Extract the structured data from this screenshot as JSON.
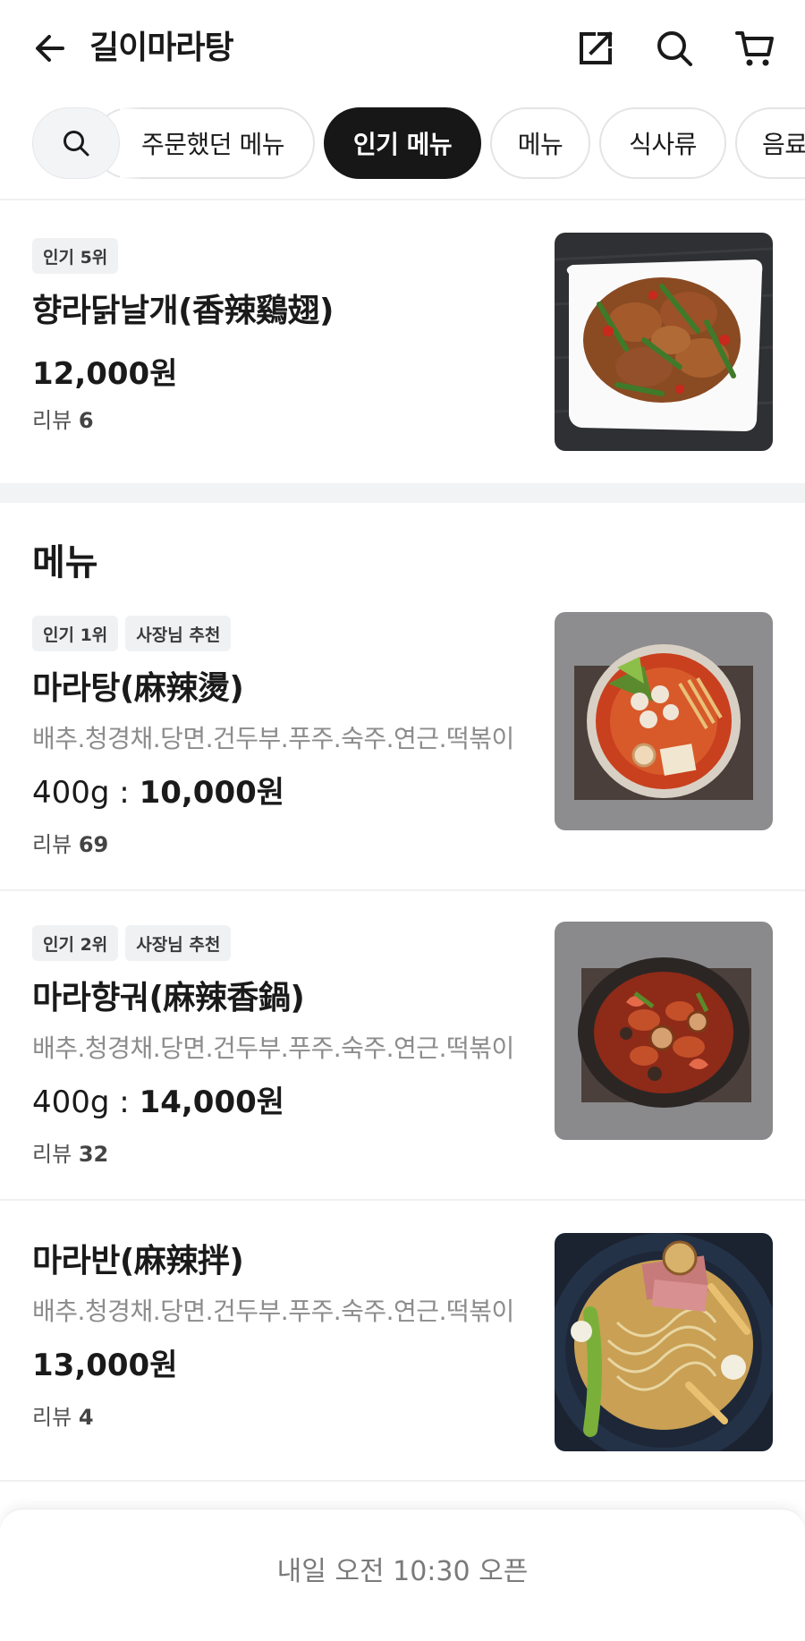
{
  "header": {
    "title": "길이마라탕",
    "back_icon": "arrow-left-icon",
    "share_icon": "share-icon",
    "search_icon": "search-icon",
    "cart_icon": "cart-icon"
  },
  "tabs": {
    "search_icon": "search-icon",
    "items": [
      {
        "label": "주문했던 메뉴",
        "active": false
      },
      {
        "label": "인기 메뉴",
        "active": true
      },
      {
        "label": "메뉴",
        "active": false
      },
      {
        "label": "식사류",
        "active": false
      },
      {
        "label": "음료",
        "active": false
      }
    ]
  },
  "popular_item": {
    "badge": "인기 5위",
    "name": "향라닭날개(香辣鷄翅)",
    "price": "12,000원",
    "review_label": "리뷰",
    "review_count": "6",
    "image": "spicy chicken wings dish"
  },
  "menu_section": {
    "title": "메뉴",
    "items": [
      {
        "badges": [
          "인기 1위",
          "사장님 추천"
        ],
        "name": "마라탕(麻辣燙)",
        "desc": "배추.청경채.당면.건두부.푸주.숙주.연근.떡볶이",
        "price_prefix": "400g : ",
        "price": "10,000원",
        "review_label": "리뷰",
        "review_count": "69"
      },
      {
        "badges": [
          "인기 2위",
          "사장님 추천"
        ],
        "name": "마라향궈(麻辣香鍋)",
        "desc": "배추.청경채.당면.건두부.푸주.숙주.연근.떡볶이",
        "price_prefix": "400g : ",
        "price": "14,000원",
        "review_label": "리뷰",
        "review_count": "32"
      },
      {
        "badges": [],
        "name": "마라반(麻辣拌)",
        "desc": "배추.청경채.당면.건두부.푸주.숙주.연근.떡볶이",
        "price_prefix": "",
        "price": "13,000원",
        "review_label": "리뷰",
        "review_count": "4"
      }
    ]
  },
  "bottom_bar": {
    "status": "내일 오전 10:30 오픈"
  },
  "colors": {
    "active_chip": "#171717",
    "badge_bg": "#f0f1f3",
    "section_gap": "#f2f3f5",
    "desc_text": "#8c8c8c"
  }
}
